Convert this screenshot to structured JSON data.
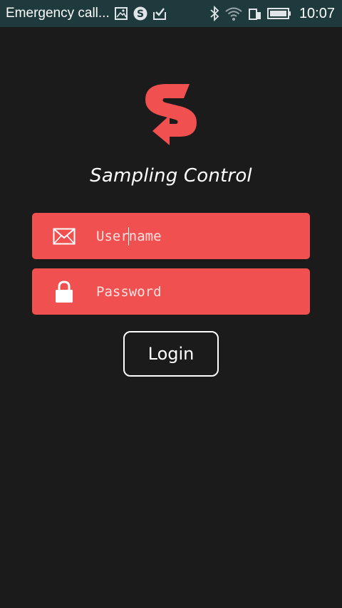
{
  "status_bar": {
    "title": "Emergency call...",
    "time": "10:07",
    "icons": [
      "image-icon",
      "skype-icon",
      "clipboard-check-icon",
      "bluetooth-icon",
      "wifi-icon",
      "sim-icon",
      "battery-icon"
    ]
  },
  "app": {
    "title": "Sampling Control",
    "brand_color": "#f0504f",
    "logo_icon": "sampling-control-logo"
  },
  "form": {
    "username_placeholder": "Username",
    "username_icon": "envelope-icon",
    "password_placeholder": "Password",
    "password_icon": "lock-icon",
    "login_label": "Login"
  }
}
